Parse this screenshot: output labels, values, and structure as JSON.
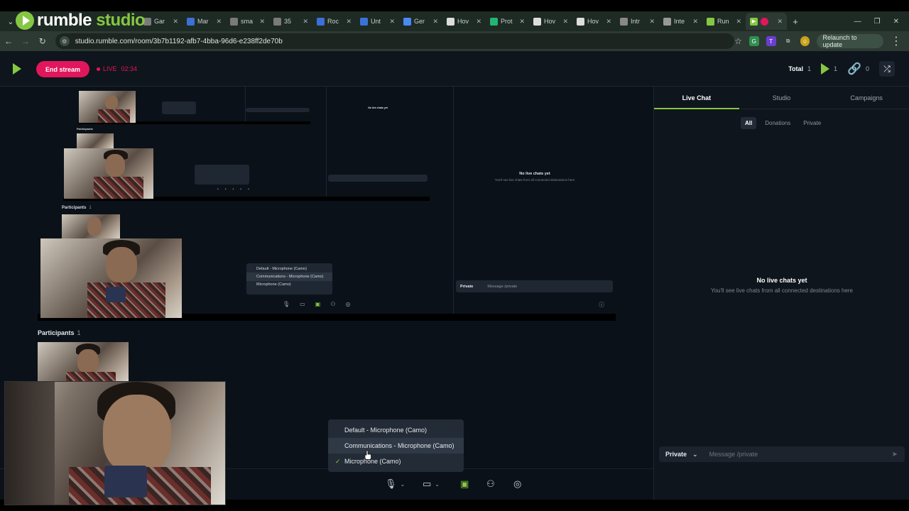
{
  "browser": {
    "tabs": [
      {
        "label": "Gar",
        "color": "#7a7a7a"
      },
      {
        "label": "Mar",
        "color": "#3c6fd8"
      },
      {
        "label": "sma",
        "color": "#7a7a7a"
      },
      {
        "label": "35",
        "color": "#7a7a7a"
      },
      {
        "label": "Roc",
        "color": "#3c6fd8"
      },
      {
        "label": "Unt",
        "color": "#3a73d6"
      },
      {
        "label": "Ger",
        "color": "#4a8af4"
      },
      {
        "label": "Hov",
        "color": "#dddddd"
      },
      {
        "label": "Prot",
        "color": "#22b573"
      },
      {
        "label": "Hov",
        "color": "#dddddd"
      },
      {
        "label": "Hov",
        "color": "#dddddd"
      },
      {
        "label": "Intr",
        "color": "#888888"
      },
      {
        "label": "Inte",
        "color": "#999999"
      },
      {
        "label": "Run",
        "color": "#85c742"
      }
    ],
    "url": "studio.rumble.com/room/3b7b1192-afb7-4bba-96d6-e238ff2de70b",
    "relaunch_label": "Relaunch to update"
  },
  "logo": {
    "brand": "rumble",
    "product": "studio"
  },
  "header": {
    "end_stream_label": "End stream",
    "live_label": "LIVE",
    "live_time": "02:34",
    "total_label": "Total",
    "total_count": "1",
    "rumble_count": "1",
    "link_count": "0"
  },
  "stage": {
    "participants_label": "Participants",
    "participants_count": "1",
    "mini_no_chats": "No live chats yet",
    "mini_no_chats_sub": "You'll see live chats from all connected destinations here",
    "mini_private": "Private",
    "mini_message_placeholder": "Message /private"
  },
  "device_menu": {
    "items": [
      {
        "label": "Default - Microphone (Camo)",
        "checked": false
      },
      {
        "label": "Communications - Microphone (Camo)",
        "checked": false
      },
      {
        "label": "Microphone (Camo)",
        "checked": true
      }
    ]
  },
  "right_panel": {
    "tabs": [
      "Live Chat",
      "Studio",
      "Campaigns"
    ],
    "filters": [
      "All",
      "Donations",
      "Private"
    ],
    "empty_title": "No live chats yet",
    "empty_sub": "You'll see live chats from all connected destinations here",
    "message_target": "Private",
    "message_placeholder": "Message /private"
  },
  "colors": {
    "accent": "#85c742",
    "live": "#e2165c",
    "background": "#0b1118"
  }
}
